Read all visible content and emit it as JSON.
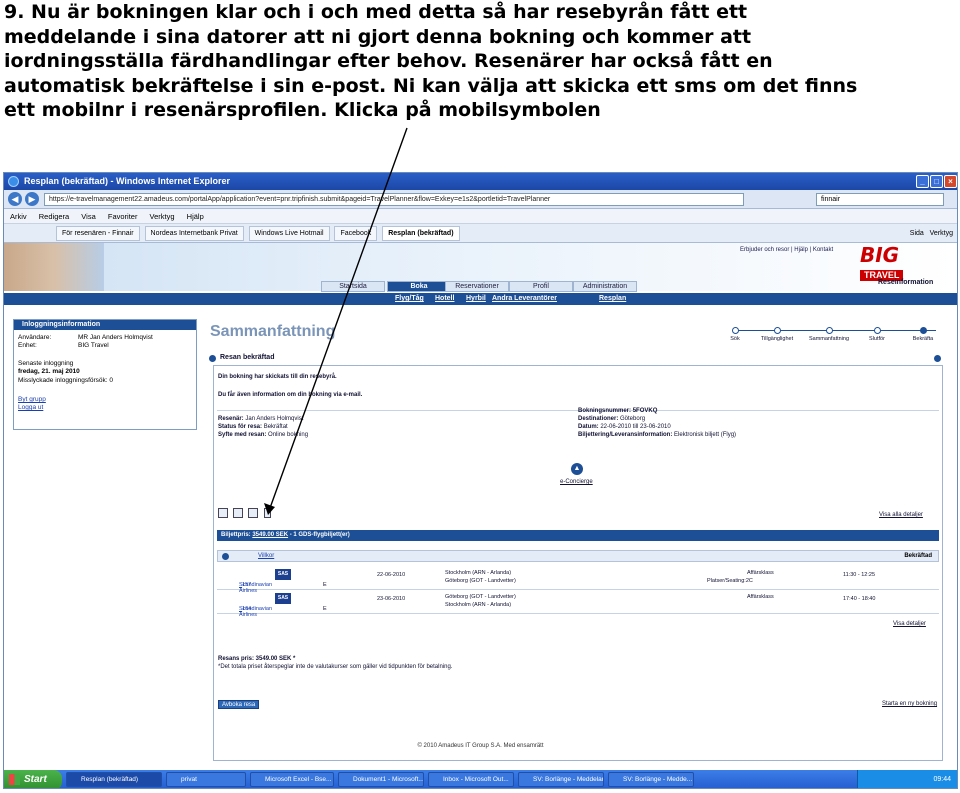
{
  "instruction": {
    "lines": [
      "9. Nu är bokningen klar och i och med detta så har resebyrån fått ett",
      "meddelande i sina datorer att ni gjort denna bokning och kommer att",
      "iordningsställa färdhandlingar efter behov. Resenärer har också fått en",
      "automatisk bekräftelse i sin e-post. Ni kan välja att skicka ett sms om det finns",
      "ett mobilnr i resenärsprofilen. Klicka på mobilsymbolen"
    ]
  },
  "browser": {
    "title": "Resplan (bekräftad) - Windows Internet Explorer",
    "url": "https://e-travelmanagement22.amadeus.com/portalApp/application?event=pnr.tripfinish.submit&pageid=TravelPlanner&flow=Exkey=e1s2&portletid=TravelPlanner",
    "search": "finnair",
    "menu": [
      "Arkiv",
      "Redigera",
      "Visa",
      "Favoriter",
      "Verktyg",
      "Hjälp"
    ],
    "favorites": [
      "För resenären - Finnair",
      "Nordeas Internetbank Privat",
      "Windows Live Hotmail",
      "Facebook",
      "Resplan (bekräftad)"
    ],
    "fav_right": [
      "Sida",
      "Verktyg"
    ]
  },
  "site": {
    "top_links": "Erbjuder och resor | Hjälp | Kontakt",
    "logo_big": "BIG",
    "logo_travel": "TRAVEL",
    "tabs": [
      "Startsida",
      "Boka",
      "Reservationer",
      "Profil",
      "Administration"
    ],
    "subnav": [
      "Flyg/Tåg",
      "Hotell",
      "Hyrbil",
      "Andra Leverantörer",
      "Resplan"
    ],
    "reseinformation": "Reseinformation"
  },
  "login_panel": {
    "header": "Inloggningsinformation",
    "user_label": "Användare:",
    "user_value": "MR Jan Anders Holmqvist",
    "unit_label": "Enhet:",
    "unit_value": "BIG Travel",
    "last_login_label": "Senaste inloggning",
    "last_login_value": "fredag, 21. maj 2010",
    "failed_label": "Misslyckade inloggningsförsök: 0",
    "change_group": "Byt grupp",
    "logout": "Logga ut"
  },
  "summary": {
    "title": "Sammanfattning",
    "steps": [
      "Sök",
      "Tillgänglighet",
      "Sammanfattning",
      "Slutför",
      "Bekräfta"
    ],
    "section": "Resan bekräftad",
    "msg1": "Din bokning har skickats till din resebyrå.",
    "msg2": "Du får även information om din bokning via e-mail.",
    "traveller_label": "Resenär:",
    "traveller_value": "Jan Anders Holmqvist",
    "status_label": "Status för resa:",
    "status_value": "Bekräftat",
    "purpose_label": "Syfte med resan:",
    "purpose_value": "Online bokning",
    "booking_no_label": "Bokningsnummer:",
    "booking_no_value": "5FOVKQ",
    "destination_label": "Destinationer:",
    "destination_value": "Göteborg",
    "dates_label": "Datum:",
    "dates_value": "22-06-2010 till 23-06-2010",
    "ticketing_label": "Biljettering/Leveransinformation:",
    "ticketing_value": "Elektronisk biljett (Flyg)",
    "concierge": "e-Concierge",
    "show_details": "Visa alla detaljer",
    "ticket_price_label": "Biljettpris:",
    "ticket_price_value": "3549.00 SEK",
    "ticket_price_rest": " - 1 GDS-flygbiljett(er)",
    "conditions": "Villkor",
    "confirmed": "Bekräftad",
    "flights": [
      {
        "airline": "Scandinavian Airlines",
        "flight": "157",
        "class_code": "E",
        "date": "22-06-2010",
        "from": "Stockholm (ARN - Arlanda)",
        "to": "Göteborg (GOT - Landvetter)",
        "cabin": "Affärsklass",
        "seat": "Platser/Seating:2C",
        "time": "11:30 - 12:25"
      },
      {
        "airline": "Scandinavian Airlines",
        "flight": "164",
        "class_code": "E",
        "date": "23-06-2010",
        "from": "Göteborg (GOT - Landvetter)",
        "to": "Stockholm (ARN - Arlanda)",
        "cabin": "Affärsklass",
        "seat": "",
        "time": "17:40 - 18:40"
      }
    ],
    "sas_logo": "SAS",
    "show_details2": "Visa detaljer",
    "trip_price": "Resans pris: 3549.00 SEK *",
    "price_note": "*Det totala priset återspeglar inte de valutakurser som gäller vid tidpunkten för betalning.",
    "cancel_trip": "Avboka resa",
    "start_new": "Starta en ny bokning",
    "footer": "© 2010 Amadeus IT Group S.A. Med ensamrätt"
  },
  "taskbar": {
    "start": "Start",
    "tasks": [
      "Resplan (bekräftad)",
      "privat",
      "Microsoft Excel - Bse...",
      "Dokument1 - Microsoft...",
      "Inbox - Microsoft Out...",
      "SV: Borlänge - Meddelandet",
      "SV: Borlänge - Medde..."
    ],
    "clock": "09:44"
  },
  "colors": {
    "accent": "#1d4f96",
    "title_text": "#7b95b8",
    "logo_red": "#cc0000"
  }
}
